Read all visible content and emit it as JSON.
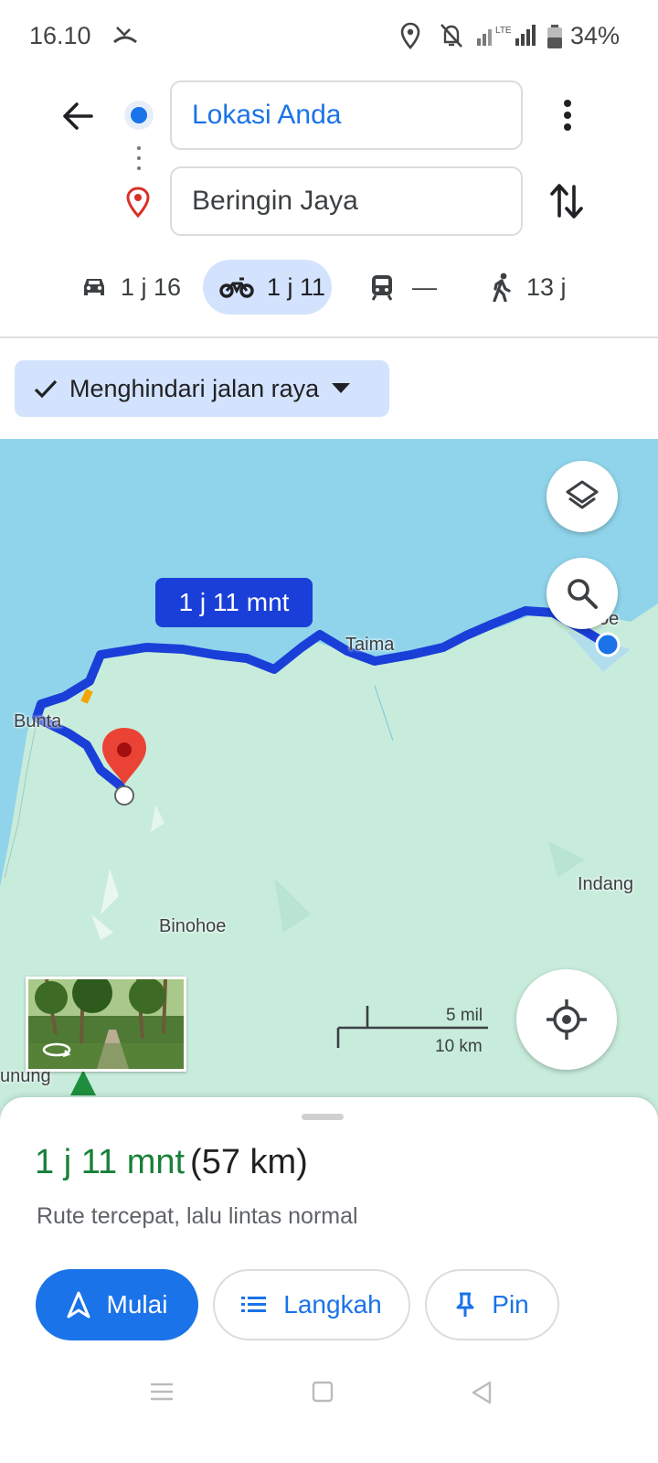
{
  "status": {
    "time": "16.10",
    "battery": "34%",
    "network": "LTE"
  },
  "search": {
    "origin": "Lokasi Anda",
    "destination": "Beringin Jaya"
  },
  "modes": [
    {
      "name": "car",
      "label": "1 j 16"
    },
    {
      "name": "motorcycle",
      "label": "1 j 11",
      "selected": true
    },
    {
      "name": "transit",
      "label": "—"
    },
    {
      "name": "walk",
      "label": "13 j"
    }
  ],
  "filter_chip": {
    "label": "Menghindari jalan raya"
  },
  "map": {
    "route_badge": "1 j 11 mnt",
    "labels": {
      "taima": "Taima",
      "bunta": "Bunta",
      "binohoe": "Binohoe",
      "indang": "Indang",
      "origin_place_partial": "oe",
      "park_partial": "unung"
    },
    "scale": {
      "miles": "5 mil",
      "kilometers": "10 km"
    },
    "colors": {
      "route": "#1a3fd8",
      "sea": "#8fd4ea",
      "land": "#c8ecdc",
      "pin": "#ea4335"
    }
  },
  "sheet": {
    "duration": "1 j 11 mnt",
    "distance": "(57 km)",
    "description": "Rute tercepat, lalu lintas normal",
    "buttons": {
      "start": "Mulai",
      "steps": "Langkah",
      "pin": "Pin"
    }
  },
  "icons": [
    "back-arrow-icon",
    "more-vert-icon",
    "swap-icon",
    "car-icon",
    "motorcycle-icon",
    "train-icon",
    "walk-icon",
    "check-icon",
    "layers-icon",
    "search-icon",
    "my-location-icon",
    "navigation-icon",
    "list-icon",
    "pin-icon"
  ]
}
